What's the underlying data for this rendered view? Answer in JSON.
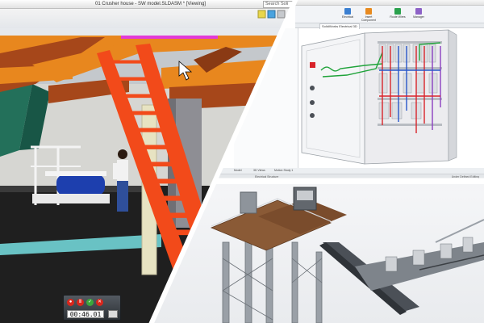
{
  "panel_a": {
    "window_title": "01 Crusher house - SW model.SLDASM * [Viewing]",
    "search_placeholder": "Search Soli",
    "timer": {
      "display": "00:46.01",
      "record_color": "#d9261c",
      "pause_color": "#d9261c",
      "check_color": "#3aa83a",
      "close_color": "#d9261c"
    },
    "colors": {
      "stair": "#f24a1a",
      "beam": "#e8871e",
      "beam_dark": "#a6471a",
      "floor": "#1f1f1f",
      "walkway": "#69c2c4",
      "motor": "#1d3fae"
    }
  },
  "panel_b": {
    "ribbon_buttons": [
      "Electrical",
      "Insert Component",
      "Route Wires",
      "Manager"
    ],
    "tab_label": "SolidWorks Electrical 3D",
    "bottom_tabs": [
      "Model",
      "3D Views",
      "Motion Study 1"
    ],
    "status_text": "Electrical Structure",
    "status_right": "Under Defined  Editing",
    "colors": {
      "cabinet": "#f1f2f4",
      "wire_green": "#1fa33a",
      "wire_red": "#d8232a",
      "wire_blue": "#2856c9",
      "wire_purple": "#8a3fc1"
    }
  },
  "panel_c": {
    "colors": {
      "tower": "#8e949b",
      "floor_wood": "#8a5a36",
      "conveyor": "#4b5057"
    }
  }
}
